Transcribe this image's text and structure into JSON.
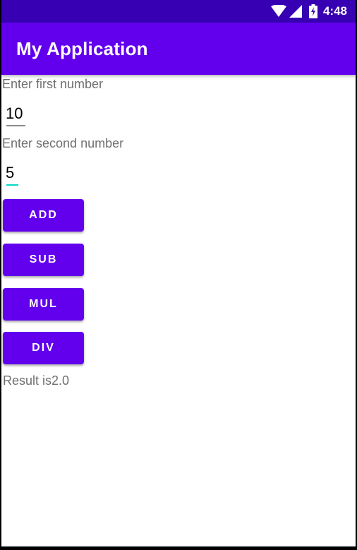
{
  "status_bar": {
    "time": "4:48",
    "icons": [
      "wifi-icon",
      "signal-icon",
      "battery-icon"
    ],
    "color": "#3700b3"
  },
  "app_bar": {
    "title": "My Application",
    "color": "#6200ee"
  },
  "form": {
    "first_label": "Enter first number",
    "first_value": "10",
    "second_label": "Enter second number",
    "second_value": "5",
    "focused_underline_color": "#03dac5"
  },
  "buttons": {
    "add": "ADD",
    "sub": "SUB",
    "mul": "MUL",
    "div": "DIV"
  },
  "result": {
    "text": "Result is2.0"
  }
}
